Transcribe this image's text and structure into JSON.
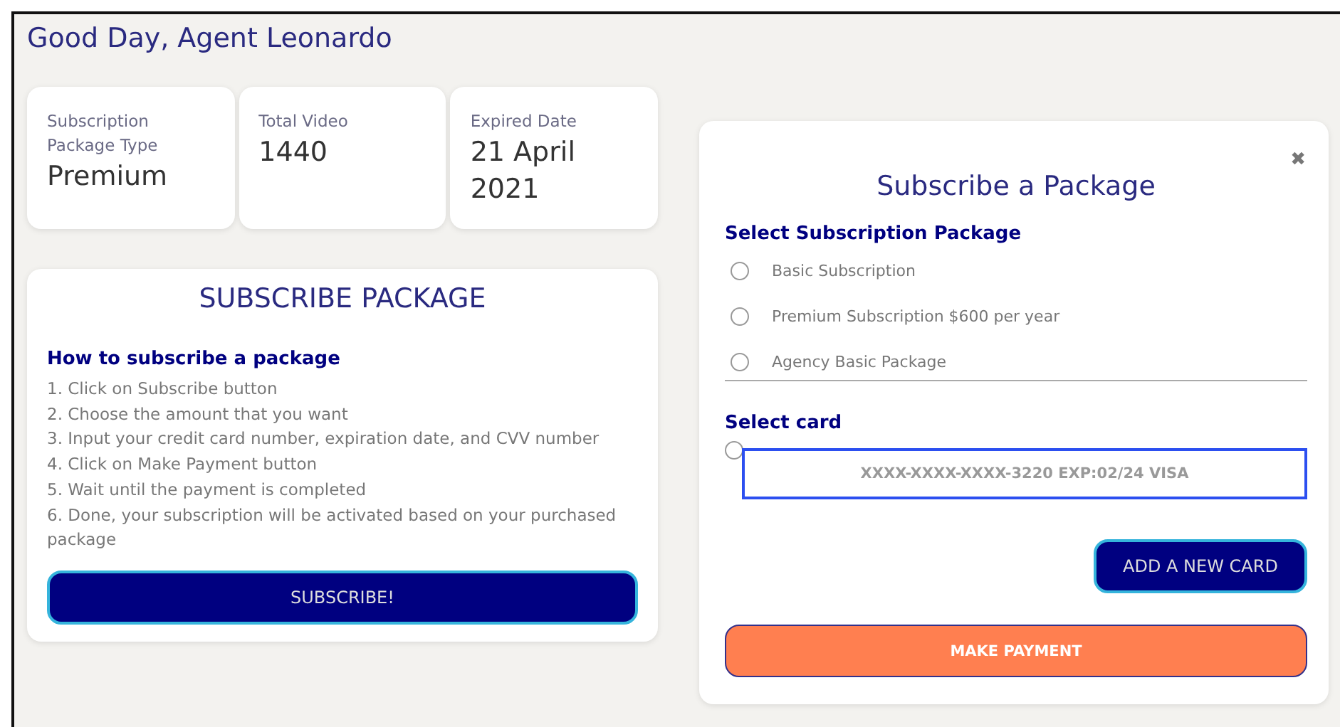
{
  "greeting": "Good Day, Agent Leonardo",
  "stats": [
    {
      "label": "Subscription Package Type",
      "value": "Premium"
    },
    {
      "label": "Total Video",
      "value": "1440"
    },
    {
      "label": "Expired Date",
      "value": "21 April 2021"
    }
  ],
  "subscribe_card": {
    "title": "SUBSCRIBE PACKAGE",
    "heading": "How to subscribe a package",
    "steps": [
      "1. Click on Subscribe button",
      "2. Choose the amount that you want",
      "3. Input your credit card number, expiration date, and CVV number",
      "4. Click on Make Payment button",
      "5. Wait until the payment is completed",
      "6. Done, your subscription will be activated based on your purchased package"
    ],
    "button": "SUBSCRIBE!"
  },
  "modal": {
    "close": "✖",
    "title": "Subscribe a Package",
    "package_heading": "Select Subscription Package",
    "packages": [
      {
        "label": "Basic Subscription",
        "selected": false
      },
      {
        "label": "Premium Subscription $600 per year",
        "selected": false
      },
      {
        "label": "Agency Basic Package",
        "selected": false
      }
    ],
    "card_heading": "Select card",
    "cards": [
      {
        "label": "XXXX-XXXX-XXXX-3220 EXP:02/24 VISA",
        "selected": false
      }
    ],
    "add_card": "ADD A NEW CARD",
    "pay": "MAKE PAYMENT"
  }
}
